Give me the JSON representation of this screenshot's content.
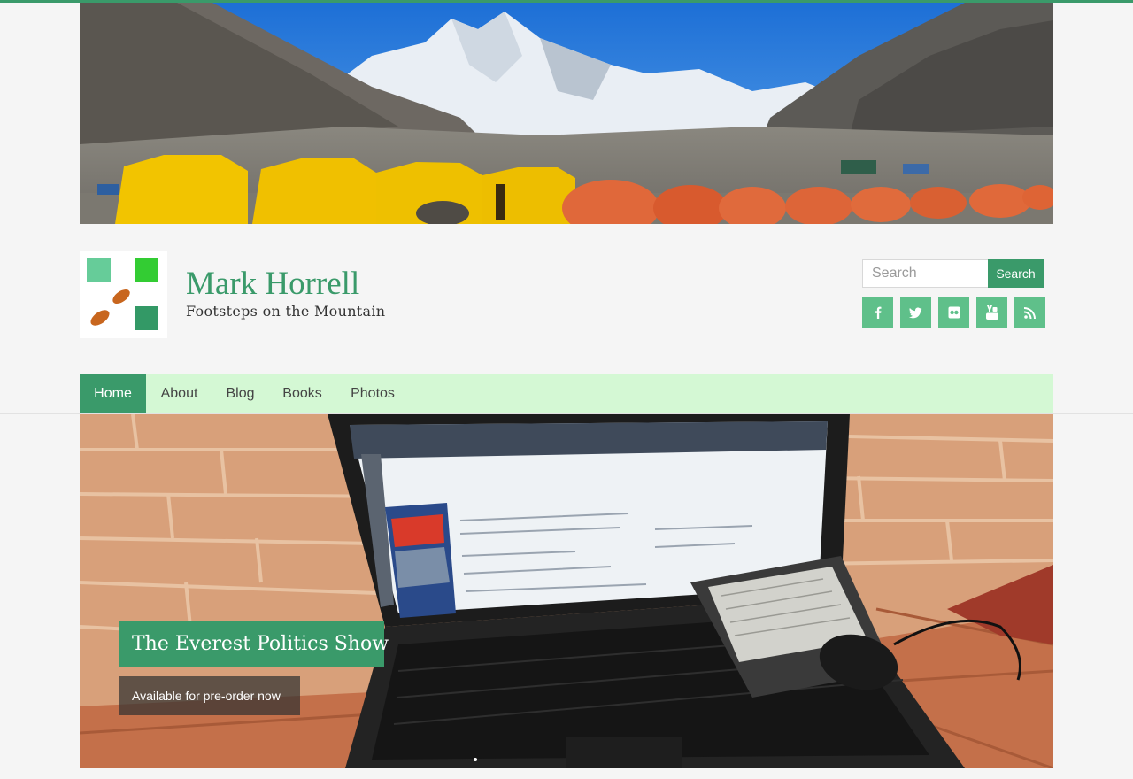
{
  "site": {
    "title": "Mark Horrell",
    "tagline": "Footsteps on the Mountain"
  },
  "colors": {
    "brand_green": "#3a9a6a",
    "nav_background": "#d4f8d4",
    "social_button": "#5fc08a"
  },
  "search": {
    "placeholder": "Search",
    "button_label": "Search"
  },
  "social": [
    {
      "icon": "facebook-icon"
    },
    {
      "icon": "twitter-icon"
    },
    {
      "icon": "flickr-icon"
    },
    {
      "icon": "youtube-icon"
    },
    {
      "icon": "rss-icon"
    }
  ],
  "nav": {
    "items": [
      {
        "label": "Home",
        "active": true
      },
      {
        "label": "About"
      },
      {
        "label": "Blog"
      },
      {
        "label": "Books"
      },
      {
        "label": "Photos"
      }
    ]
  },
  "slider": {
    "slide_title": "The Everest Politics Show",
    "slide_caption": "Available for pre-order now"
  }
}
